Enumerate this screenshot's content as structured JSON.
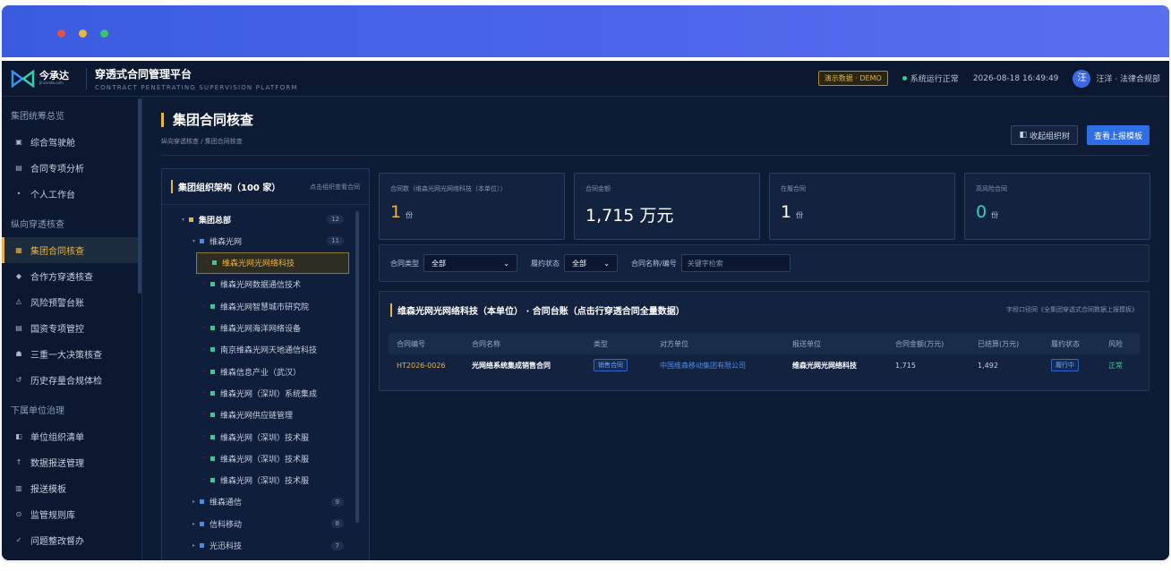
{
  "browser": {
    "dots": [
      "#e0524c",
      "#e8b443",
      "#3fc26f"
    ]
  },
  "header": {
    "logo_name": "今承达",
    "logo_sub": "Jincenda.com",
    "title": "穿透式合同管理平台",
    "subtitle": "CONTRACT PENETRATING SUPERVISION PLATFORM",
    "demo_badge": "演示数据 · DEMO",
    "status": "系统运行正常",
    "datetime": "2026-08-18 16:49:49",
    "avatar": "汪",
    "user": "汪洋 · 法律合规部"
  },
  "sidebar": {
    "groups": [
      {
        "label": "集团统筹总览",
        "items": [
          {
            "icon": "dashboard-icon",
            "glyph": "▣",
            "label": "综合驾驶舱"
          },
          {
            "icon": "list-icon",
            "glyph": "▤",
            "label": "合同专项分析"
          },
          {
            "icon": "dot-icon",
            "glyph": "•",
            "label": "个人工作台"
          }
        ]
      },
      {
        "label": "纵向穿透核查",
        "items": [
          {
            "icon": "grid-icon",
            "glyph": "▦",
            "label": "集团合同核查",
            "active": true
          },
          {
            "icon": "diamond-icon",
            "glyph": "◆",
            "label": "合作方穿透核查"
          },
          {
            "icon": "warning-icon",
            "glyph": "⚠",
            "label": "风险预警台账"
          },
          {
            "icon": "archive-icon",
            "glyph": "▤",
            "label": "国资专项管控"
          },
          {
            "icon": "people-icon",
            "glyph": "☗",
            "label": "三重一大决策核查"
          },
          {
            "icon": "history-icon",
            "glyph": "↺",
            "label": "历史存量合规体检"
          }
        ]
      },
      {
        "label": "下属单位治理",
        "items": [
          {
            "icon": "org-icon",
            "glyph": "◧",
            "label": "单位组织清单"
          },
          {
            "icon": "upload-icon",
            "glyph": "↑",
            "label": "数据报送管理"
          },
          {
            "icon": "template-icon",
            "glyph": "▥",
            "label": "报送模板"
          },
          {
            "icon": "rules-icon",
            "glyph": "⊙",
            "label": "监管规则库"
          },
          {
            "icon": "check-icon",
            "glyph": "✓",
            "label": "问题整改督办"
          }
        ]
      }
    ]
  },
  "page": {
    "title": "集团合同核查",
    "breadcrumb": "纵向穿透核查 / 集团合同核查",
    "collapse_btn": "收起组织树",
    "report_btn": "查看上报模板"
  },
  "tree": {
    "title": "集团组织架构（100 家）",
    "hint": "点击组织查看合同",
    "nodes": [
      {
        "level": 0,
        "label": "集团总部",
        "count": "12",
        "arrow": "▾",
        "color": "#e8b443",
        "bold": true
      },
      {
        "level": 1,
        "label": "维森光网",
        "count": "11",
        "arrow": "▾",
        "color": "#3d8ef0"
      },
      {
        "level": 2,
        "label": "维森光网光网络科技",
        "count": "",
        "arrow": "·",
        "color": "#2fd18a",
        "selected": true
      },
      {
        "level": 2,
        "label": "维森光网数据通信技术",
        "count": "",
        "arrow": "·",
        "color": "#2fd18a"
      },
      {
        "level": 2,
        "label": "维森光网智慧城市研究院",
        "count": "",
        "arrow": "·",
        "color": "#2fd18a"
      },
      {
        "level": 2,
        "label": "维森光网海洋网络设备",
        "count": "",
        "arrow": "·",
        "color": "#2fd18a"
      },
      {
        "level": 2,
        "label": "南京维森光网天地通信科技",
        "count": "",
        "arrow": "·",
        "color": "#2fd18a"
      },
      {
        "level": 2,
        "label": "维森信息产业（武汉）",
        "count": "",
        "arrow": "·",
        "color": "#2fd18a"
      },
      {
        "level": 2,
        "label": "维森光网（深圳）系统集成",
        "count": "",
        "arrow": "·",
        "color": "#2fd18a"
      },
      {
        "level": 2,
        "label": "维森光网供应链管理",
        "count": "",
        "arrow": "·",
        "color": "#2fd18a"
      },
      {
        "level": 2,
        "label": "维森光网（深圳）技术服",
        "count": "",
        "arrow": "·",
        "color": "#2fd18a"
      },
      {
        "level": 2,
        "label": "维森光网（深圳）技术服",
        "count": "",
        "arrow": "·",
        "color": "#2fd18a"
      },
      {
        "level": 2,
        "label": "维森光网（深圳）技术服",
        "count": "",
        "arrow": "·",
        "color": "#2fd18a"
      },
      {
        "level": 1,
        "label": "维森通信",
        "count": "9",
        "arrow": "▸",
        "color": "#3d8ef0"
      },
      {
        "level": 1,
        "label": "信科移动",
        "count": "8",
        "arrow": "▸",
        "color": "#3d8ef0"
      },
      {
        "level": 1,
        "label": "光迅科技",
        "count": "7",
        "arrow": "▸",
        "color": "#3d8ef0"
      }
    ]
  },
  "cards": [
    {
      "label": "合同数（维森光网光网络科技（本单位））",
      "value": "1",
      "unit": "份",
      "color": "gold"
    },
    {
      "label": "合同金额",
      "value": "1,715 万元",
      "unit": "",
      "color": "white"
    },
    {
      "label": "在履合同",
      "value": "1",
      "unit": "份",
      "color": "white"
    },
    {
      "label": "高风险合同",
      "value": "0",
      "unit": "份",
      "color": "teal"
    }
  ],
  "filter": {
    "type_label": "合同类型",
    "type_value": "全部",
    "status_label": "履约状态",
    "status_value": "全部",
    "search_label": "合同名称/编号",
    "search_placeholder": "关键字检索"
  },
  "ledger": {
    "title": "维森光网光网络科技（本单位） · 合同台账（点击行穿透合同全量数据）",
    "hint": "字段口径同《全集团穿透式合同数据上报模板》",
    "columns": [
      "合同编号",
      "合同名称",
      "类型",
      "对方单位",
      "报送单位",
      "合同金额(万元)",
      "已结算(万元)",
      "履约状态",
      "风险"
    ],
    "rows": [
      [
        "HT2026-0026",
        "光网络系统集成销售合同",
        "销售合同",
        "中国维森移动集团有限公司",
        "维森光网光网络科技",
        "1,715",
        "1,492",
        "履行中",
        "正常"
      ]
    ]
  }
}
